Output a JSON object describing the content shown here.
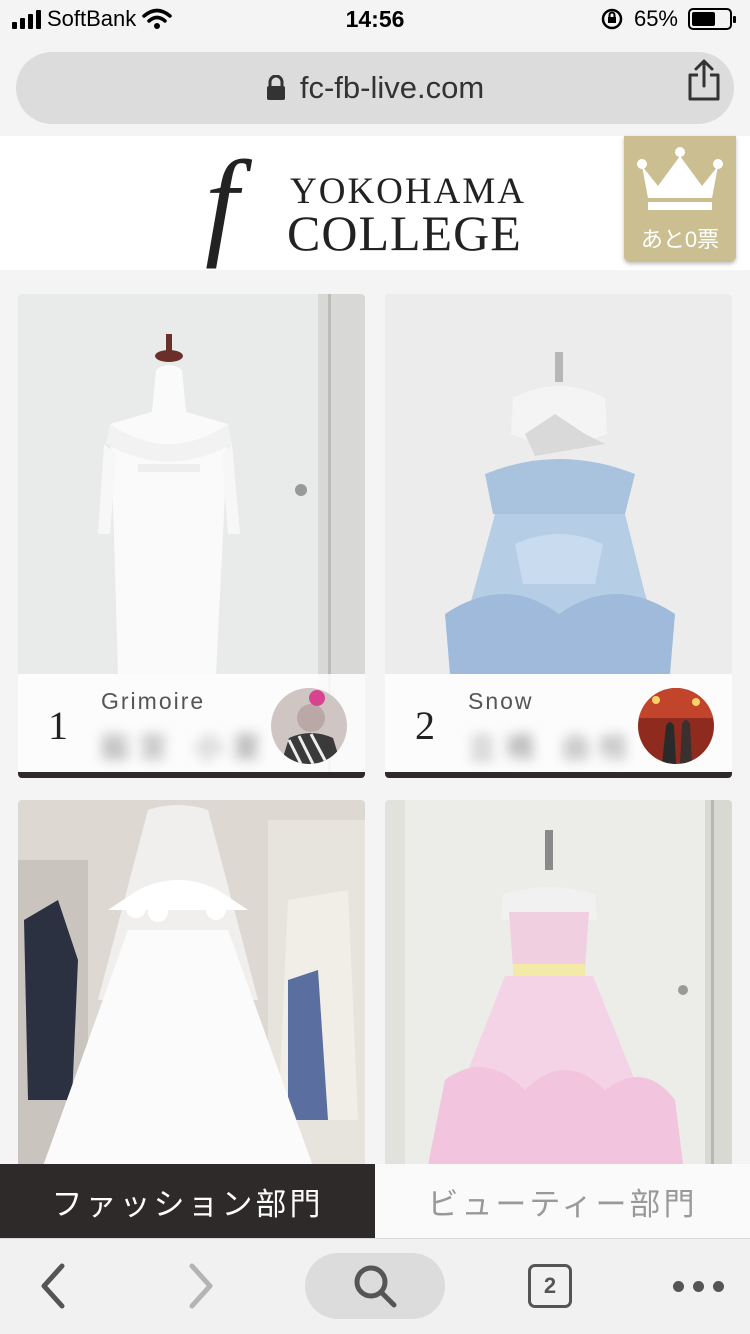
{
  "status": {
    "carrier": "SoftBank",
    "time": "14:56",
    "battery": "65%",
    "battery_level": 0.65
  },
  "browser": {
    "url": "fc-fb-live.com",
    "tab_count": "2"
  },
  "header": {
    "logo_mark": "f",
    "logo_line1": "YOKOHAMA",
    "logo_line2": "COLLEGE",
    "votes_left": "あと0票"
  },
  "entries": [
    {
      "rank": "1",
      "work": "Grimoire",
      "student": "脇宮 小夏"
    },
    {
      "rank": "2",
      "work": "Snow",
      "student": "立橋 由枝"
    }
  ],
  "categories": {
    "fashion": "ファッション部門",
    "beauty": "ビューティー部門"
  },
  "colors": {
    "accent_dark": "#2e2a2a",
    "gold": "#cbbf92"
  }
}
